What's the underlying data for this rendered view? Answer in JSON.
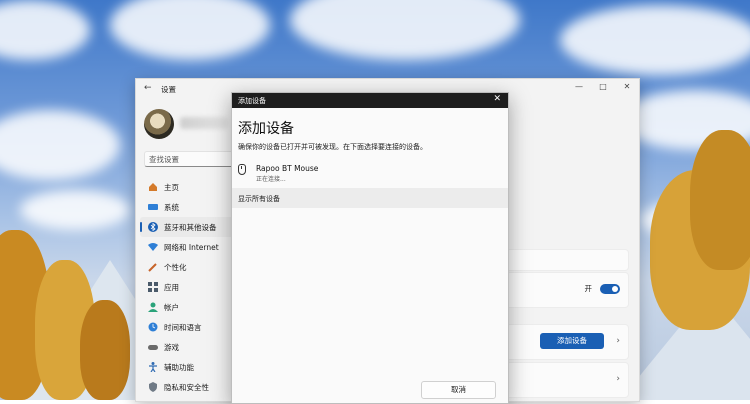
{
  "settings_window": {
    "title": "设置",
    "search_placeholder": "查找设置",
    "nav_items": [
      {
        "label": "主页",
        "icon": "home-icon"
      },
      {
        "label": "系统",
        "icon": "system-icon"
      },
      {
        "label": "蓝牙和其他设备",
        "icon": "bluetooth-icon"
      },
      {
        "label": "网络和 Internet",
        "icon": "network-icon"
      },
      {
        "label": "个性化",
        "icon": "personalization-icon"
      },
      {
        "label": "应用",
        "icon": "apps-icon"
      },
      {
        "label": "帐户",
        "icon": "accounts-icon"
      },
      {
        "label": "时间和语言",
        "icon": "time-language-icon"
      },
      {
        "label": "游戏",
        "icon": "gaming-icon"
      },
      {
        "label": "辅助功能",
        "icon": "accessibility-icon"
      },
      {
        "label": "隐私和安全性",
        "icon": "privacy-icon"
      }
    ],
    "active_nav_index": 2,
    "bluetooth_toggle_label": "开",
    "add_device_label": "添加设备",
    "accent_color": "#1a5fb4"
  },
  "dialog": {
    "title": "添加设备",
    "heading": "添加设备",
    "description": "确保你的设备已打开并可被发现。在下面选择要连接的设备。",
    "device_name": "Rapoo BT Mouse",
    "device_status": "正在连接...",
    "show_all_label": "显示所有设备",
    "cancel_label": "取消"
  }
}
